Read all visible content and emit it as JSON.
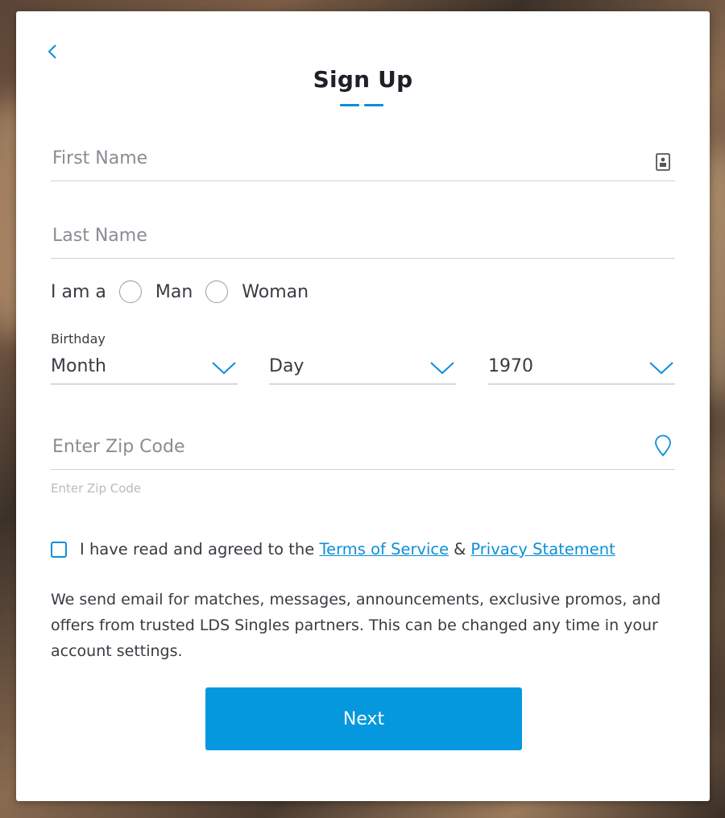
{
  "signup": {
    "title": "Sign Up",
    "progress_steps": 2,
    "first_name": {
      "placeholder": "First Name",
      "icon": "contact-card-icon"
    },
    "last_name": {
      "placeholder": "Last Name"
    },
    "gender": {
      "label": "I am a",
      "options": [
        "Man",
        "Woman"
      ]
    },
    "birthday": {
      "label": "Birthday",
      "month": "Month",
      "day": "Day",
      "year": "1970"
    },
    "zip": {
      "placeholder": "Enter Zip Code",
      "hint": "Enter Zip Code",
      "icon": "location-pin-icon"
    },
    "agreement": {
      "prefix": "I have read and agreed to the",
      "terms_link": "Terms of Service",
      "ampersand": "&",
      "privacy_link": "Privacy Statement"
    },
    "disclaimer": "We send email for matches, messages, announcements, exclusive promos, and offers from trusted LDS Singles partners. This can be changed any time in your account settings.",
    "next_label": "Next"
  },
  "colors": {
    "accent": "#0b8fd9",
    "button": "#0598de",
    "text": "#3a3b42"
  }
}
